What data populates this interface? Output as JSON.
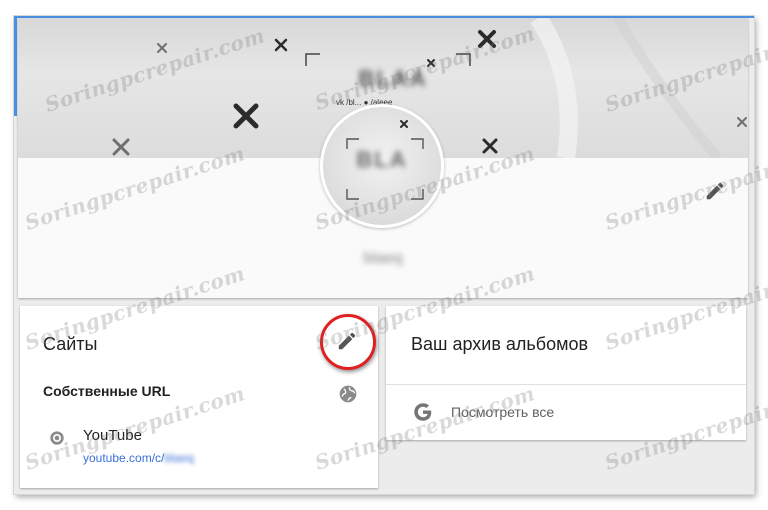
{
  "watermark": "Soringpcrepair.com",
  "profile": {
    "cover_title": "BLAA",
    "cover_social": "vk /bl...  ● /aleee",
    "avatar_text": "BLA",
    "name": "blaeq",
    "edit_icon": "pencil-icon"
  },
  "sites": {
    "title": "Сайты",
    "edit_icon": "pencil-icon",
    "highlight_color": "#e02020",
    "custom_urls_label": "Собственные URL",
    "visibility_icon": "globe-icon",
    "links": [
      {
        "icon": "globe-icon",
        "name": "YouTube",
        "url_prefix": "youtube.com/c/",
        "url_suffix": "blaeq"
      }
    ]
  },
  "albums": {
    "title": "Ваш архив альбомов",
    "view_all_icon": "google-g-icon",
    "view_all_label": "Посмотреть все"
  },
  "colors": {
    "accent": "#4a90e2",
    "link": "#3b6fd8"
  }
}
